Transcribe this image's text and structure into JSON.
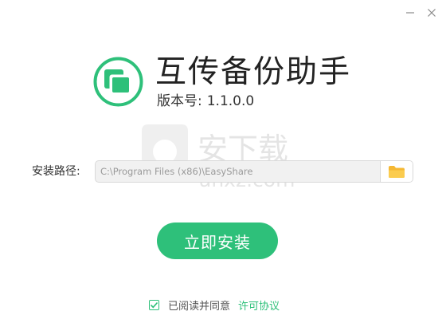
{
  "window": {
    "minimize_icon": "minimize-icon",
    "close_icon": "close-icon"
  },
  "header": {
    "app_name": "互传备份助手",
    "version_label": "版本号:",
    "version_value": "1.1.0.0",
    "logo_icon": "app-logo-icon"
  },
  "install_path": {
    "label": "安装路径:",
    "value": "C:\\Program Files (x86)\\EasyShare",
    "browse_icon": "folder-icon"
  },
  "install_button": {
    "label": "立即安装"
  },
  "agreement": {
    "checked": true,
    "text": "已阅读并同意",
    "link_text": "许可协议"
  },
  "watermark": {
    "text": "安下载",
    "subtext": "anxz.com"
  },
  "colors": {
    "accent": "#2ec07a",
    "folder": "#f5b833",
    "path_bg": "#f1f1f1"
  }
}
